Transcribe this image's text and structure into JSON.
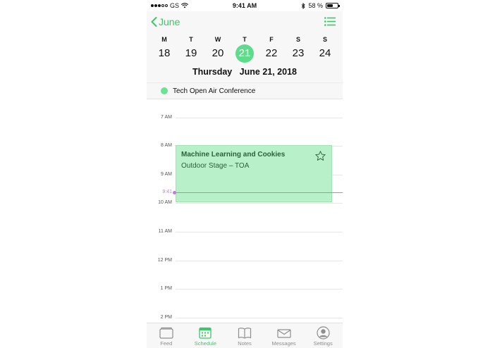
{
  "status_bar": {
    "carrier": "GS",
    "time": "9:41 AM",
    "battery": "58 %",
    "battery_level": 0.58
  },
  "header": {
    "back_label": "June",
    "back_icon": "chevron-left-icon",
    "list_icon": "list-icon",
    "accent_color": "#3cc76a"
  },
  "week": [
    {
      "letter": "M",
      "num": "18"
    },
    {
      "letter": "T",
      "num": "19"
    },
    {
      "letter": "W",
      "num": "20"
    },
    {
      "letter": "T",
      "num": "21",
      "selected": true
    },
    {
      "letter": "F",
      "num": "22"
    },
    {
      "letter": "S",
      "num": "23"
    },
    {
      "letter": "S",
      "num": "24"
    }
  ],
  "date_title": "Thursday   June 21, 2018",
  "all_day_event": {
    "title": "Tech Open Air Conference",
    "color": "#6ee192"
  },
  "timeline": {
    "hours": [
      "7 AM",
      "8 AM",
      "9 AM",
      "10 AM",
      "11 AM",
      "12 PM",
      "1 PM",
      "2 PM"
    ],
    "now_label": "9:41",
    "now_color": "#c37cd9"
  },
  "event": {
    "title": "Machine Learning and Cookies",
    "location": "Outdoor Stage – TOA",
    "star_icon": "star-outline-icon",
    "color": "#b8f0c9"
  },
  "tabs": [
    {
      "label": "Feed",
      "icon": "feed-icon"
    },
    {
      "label": "Schedule",
      "icon": "calendar-icon",
      "active": true
    },
    {
      "label": "Notes",
      "icon": "book-icon"
    },
    {
      "label": "Messages",
      "icon": "envelope-icon"
    },
    {
      "label": "Settings",
      "icon": "person-icon"
    }
  ]
}
